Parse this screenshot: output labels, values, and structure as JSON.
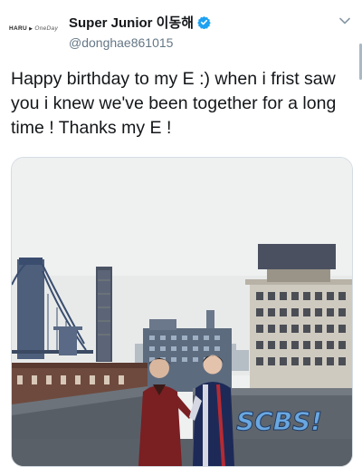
{
  "tweet": {
    "avatar": {
      "brand_bold": "HARU",
      "brand_sep": "▶",
      "brand_italic": "OneDay"
    },
    "display_name": "Super Junior 이동해",
    "handle": "@donghae861015",
    "text": "Happy birthday to my E :) when i frist saw you i knew we've been together for a long time ! Thanks my E !",
    "icons": {
      "verified": "verified-badge-icon",
      "menu": "chevron-down-icon"
    },
    "media": {
      "kind": "photo",
      "graffiti_text": "SCBS!"
    }
  },
  "colors": {
    "text": "#14171a",
    "secondary_text": "#657786",
    "verified_blue": "#1da1f2"
  }
}
